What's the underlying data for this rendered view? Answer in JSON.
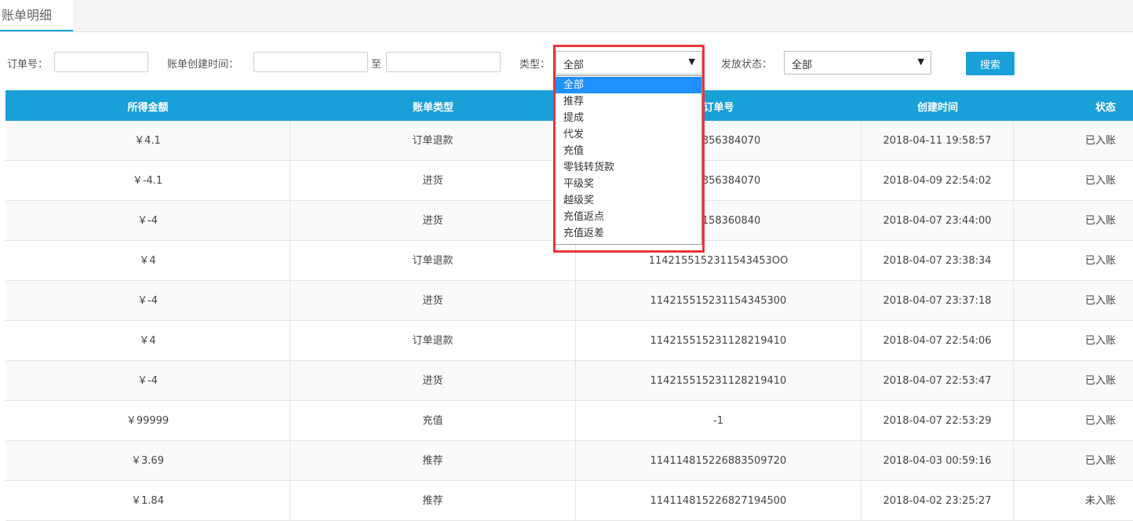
{
  "tab": {
    "label": "账单明细"
  },
  "filters": {
    "order_no_label": "订单号：",
    "order_no_value": "",
    "created_time_label": "账单创建时间：",
    "created_from_value": "",
    "to_label": "至",
    "created_to_value": "",
    "type_label": "类型：",
    "type_selected": "全部",
    "status_label": "发放状态：",
    "status_selected": "全部",
    "search_label": "搜索"
  },
  "type_dropdown": {
    "options": [
      "全部",
      "推荐",
      "提成",
      "代发",
      "充值",
      "零钱转货款",
      "平级奖",
      "越级奖",
      "充值返点",
      "充值返差"
    ],
    "active_index": 0
  },
  "table": {
    "headers": [
      "所得金额",
      "账单类型",
      "订单号",
      "创建时间",
      "状态"
    ],
    "rows": [
      [
        "￥4.1",
        "订单退款",
        "5232856384070",
        "2018-04-11 19:58:57",
        "已入账"
      ],
      [
        "￥-4.1",
        "进货",
        "5232856384070",
        "2018-04-09 22:54:02",
        "已入账"
      ],
      [
        "￥-4",
        "进货",
        "5231158360840",
        "2018-04-07 23:44:00",
        "已入账"
      ],
      [
        "￥4",
        "订单退款",
        "1142155152311543453OO",
        "2018-04-07 23:38:34",
        "已入账"
      ],
      [
        "￥-4",
        "进货",
        "114215515231154345300",
        "2018-04-07 23:37:18",
        "已入账"
      ],
      [
        "￥4",
        "订单退款",
        "114215515231128219410",
        "2018-04-07 22:54:06",
        "已入账"
      ],
      [
        "￥-4",
        "进货",
        "114215515231128219410",
        "2018-04-07 22:53:47",
        "已入账"
      ],
      [
        "￥99999",
        "充值",
        "-1",
        "2018-04-07 22:53:29",
        "已入账"
      ],
      [
        "￥3.69",
        "推荐",
        "114114815226883509720",
        "2018-04-03 00:59:16",
        "已入账"
      ],
      [
        "￥1.84",
        "推荐",
        "114114815226827194500",
        "2018-04-02 23:25:27",
        "未入账"
      ]
    ]
  },
  "colors": {
    "accent": "#1aa0d8",
    "dropdown_active": "#1e90ff",
    "highlight_border": "#e8353a"
  }
}
